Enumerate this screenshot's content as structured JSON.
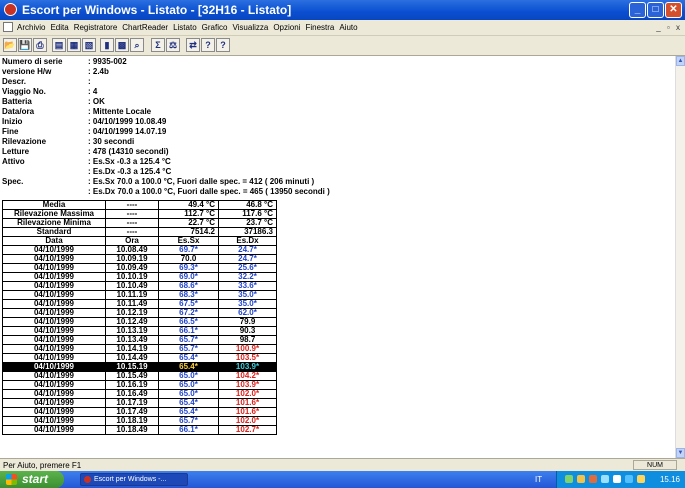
{
  "window": {
    "title": "Escort per Windows - Listato - [32H16 - Listato]"
  },
  "menu": [
    "Archivio",
    "Edita",
    "Registratore",
    "ChartReader",
    "Listato",
    "Grafico",
    "Visualizza",
    "Opzioni",
    "Finestra",
    "Aiuto"
  ],
  "toolbar": {
    "icons": [
      "open-icon",
      "save-icon",
      "print-icon",
      "print-preview-icon",
      "print-setup-icon",
      "print-all-icon",
      "bars-icon",
      "chart-icon",
      "zoom-icon",
      "stats-icon",
      "scale-icon",
      "comm-icon",
      "help-icon",
      "context-help-icon"
    ]
  },
  "info": [
    {
      "key": "Numero di serie",
      "value": ": 9935-002"
    },
    {
      "key": "versione H/w",
      "value": ": 2.4b"
    },
    {
      "key": "Descr.",
      "value": ":"
    },
    {
      "key": "Viaggio No.",
      "value": ": 4"
    },
    {
      "key": "Batteria",
      "value": ": OK"
    },
    {
      "key": "Data/ora",
      "value": ": Mittente Locale"
    },
    {
      "key": "Inizio",
      "value": ": 04/10/1999 10.08.49"
    },
    {
      "key": "Fine",
      "value": ": 04/10/1999 14.07.19"
    },
    {
      "key": "Rilevazione",
      "value": ": 30 secondi"
    },
    {
      "key": "Letture",
      "value": ": 478 (14310 secondi)"
    },
    {
      "key": "Attivo",
      "value": ": Es.Sx  -0.3 a 125.4 °C"
    },
    {
      "key": "",
      "value": ": Es.Dx  -0.3 a 125.4 °C"
    },
    {
      "key": "Spec.",
      "value": ": Es.Sx 70.0 a 100.0 °C, Fuori dalle spec. = 412 ( 206 minuti )"
    },
    {
      "key": "",
      "value": ": Es.Dx 70.0 a 100.0 °C, Fuori dalle spec. = 465 ( 13950 secondi )"
    }
  ],
  "summary": [
    [
      "Media",
      "----",
      "49.4 °C",
      "46.8 °C"
    ],
    [
      "Rilevazione Massima",
      "----",
      "112.7 °C",
      "117.6 °C"
    ],
    [
      "Rilevazione Minima",
      "----",
      "22.7 °C",
      "23.7 °C"
    ],
    [
      "Standard",
      "----",
      "7514.2",
      "37186.3"
    ]
  ],
  "columns": [
    "Data",
    "Ora",
    "Es.Sx",
    "Es.Dx"
  ],
  "rows": [
    {
      "d": "04/10/1999",
      "t": "10.08.49",
      "sx": "69.7*",
      "sxc": "blue",
      "dx": "24.7*",
      "dxc": "blue"
    },
    {
      "d": "04/10/1999",
      "t": "10.09.19",
      "sx": "70.0",
      "sxc": "",
      "dx": "24.7*",
      "dxc": "blue"
    },
    {
      "d": "04/10/1999",
      "t": "10.09.49",
      "sx": "69.3*",
      "sxc": "blue",
      "dx": "25.6*",
      "dxc": "blue"
    },
    {
      "d": "04/10/1999",
      "t": "10.10.19",
      "sx": "69.0*",
      "sxc": "blue",
      "dx": "32.2*",
      "dxc": "blue"
    },
    {
      "d": "04/10/1999",
      "t": "10.10.49",
      "sx": "68.6*",
      "sxc": "blue",
      "dx": "33.6*",
      "dxc": "blue"
    },
    {
      "d": "04/10/1999",
      "t": "10.11.19",
      "sx": "68.3*",
      "sxc": "blue",
      "dx": "35.0*",
      "dxc": "blue"
    },
    {
      "d": "04/10/1999",
      "t": "10.11.49",
      "sx": "67.5*",
      "sxc": "blue",
      "dx": "35.0*",
      "dxc": "blue"
    },
    {
      "d": "04/10/1999",
      "t": "10.12.19",
      "sx": "67.2*",
      "sxc": "blue",
      "dx": "62.0*",
      "dxc": "blue"
    },
    {
      "d": "04/10/1999",
      "t": "10.12.49",
      "sx": "66.5*",
      "sxc": "blue",
      "dx": "79.9",
      "dxc": ""
    },
    {
      "d": "04/10/1999",
      "t": "10.13.19",
      "sx": "66.1*",
      "sxc": "blue",
      "dx": "90.3",
      "dxc": ""
    },
    {
      "d": "04/10/1999",
      "t": "10.13.49",
      "sx": "65.7*",
      "sxc": "blue",
      "dx": "98.7",
      "dxc": ""
    },
    {
      "d": "04/10/1999",
      "t": "10.14.19",
      "sx": "65.7*",
      "sxc": "blue",
      "dx": "100.9*",
      "dxc": "red"
    },
    {
      "d": "04/10/1999",
      "t": "10.14.49",
      "sx": "65.4*",
      "sxc": "blue",
      "dx": "103.5*",
      "dxc": "red"
    },
    {
      "d": "04/10/1999",
      "t": "10.15.19",
      "sx": "65.4*",
      "sxc": "blue",
      "dx": "103.9*",
      "dxc": "red",
      "selected": true
    },
    {
      "d": "04/10/1999",
      "t": "10.15.49",
      "sx": "65.0*",
      "sxc": "blue",
      "dx": "104.2*",
      "dxc": "red"
    },
    {
      "d": "04/10/1999",
      "t": "10.16.19",
      "sx": "65.0*",
      "sxc": "blue",
      "dx": "103.9*",
      "dxc": "red"
    },
    {
      "d": "04/10/1999",
      "t": "10.16.49",
      "sx": "65.0*",
      "sxc": "blue",
      "dx": "102.0*",
      "dxc": "red"
    },
    {
      "d": "04/10/1999",
      "t": "10.17.19",
      "sx": "65.4*",
      "sxc": "blue",
      "dx": "101.6*",
      "dxc": "red"
    },
    {
      "d": "04/10/1999",
      "t": "10.17.49",
      "sx": "65.4*",
      "sxc": "blue",
      "dx": "101.6*",
      "dxc": "red"
    },
    {
      "d": "04/10/1999",
      "t": "10.18.19",
      "sx": "65.7*",
      "sxc": "blue",
      "dx": "102.0*",
      "dxc": "red"
    },
    {
      "d": "04/10/1999",
      "t": "10.18.49",
      "sx": "66.1*",
      "sxc": "blue",
      "dx": "102.7*",
      "dxc": "red"
    }
  ],
  "status": {
    "message": "Per Aiuto, premere F1",
    "num": "NUM"
  },
  "taskbar": {
    "start": "start",
    "task": "Escort per Windows -...",
    "lang": "IT",
    "clock": "15.16"
  },
  "colors": {
    "out_low": "#2244cc",
    "out_high": "#e0201a",
    "title_bar": "#0a4fd0"
  }
}
